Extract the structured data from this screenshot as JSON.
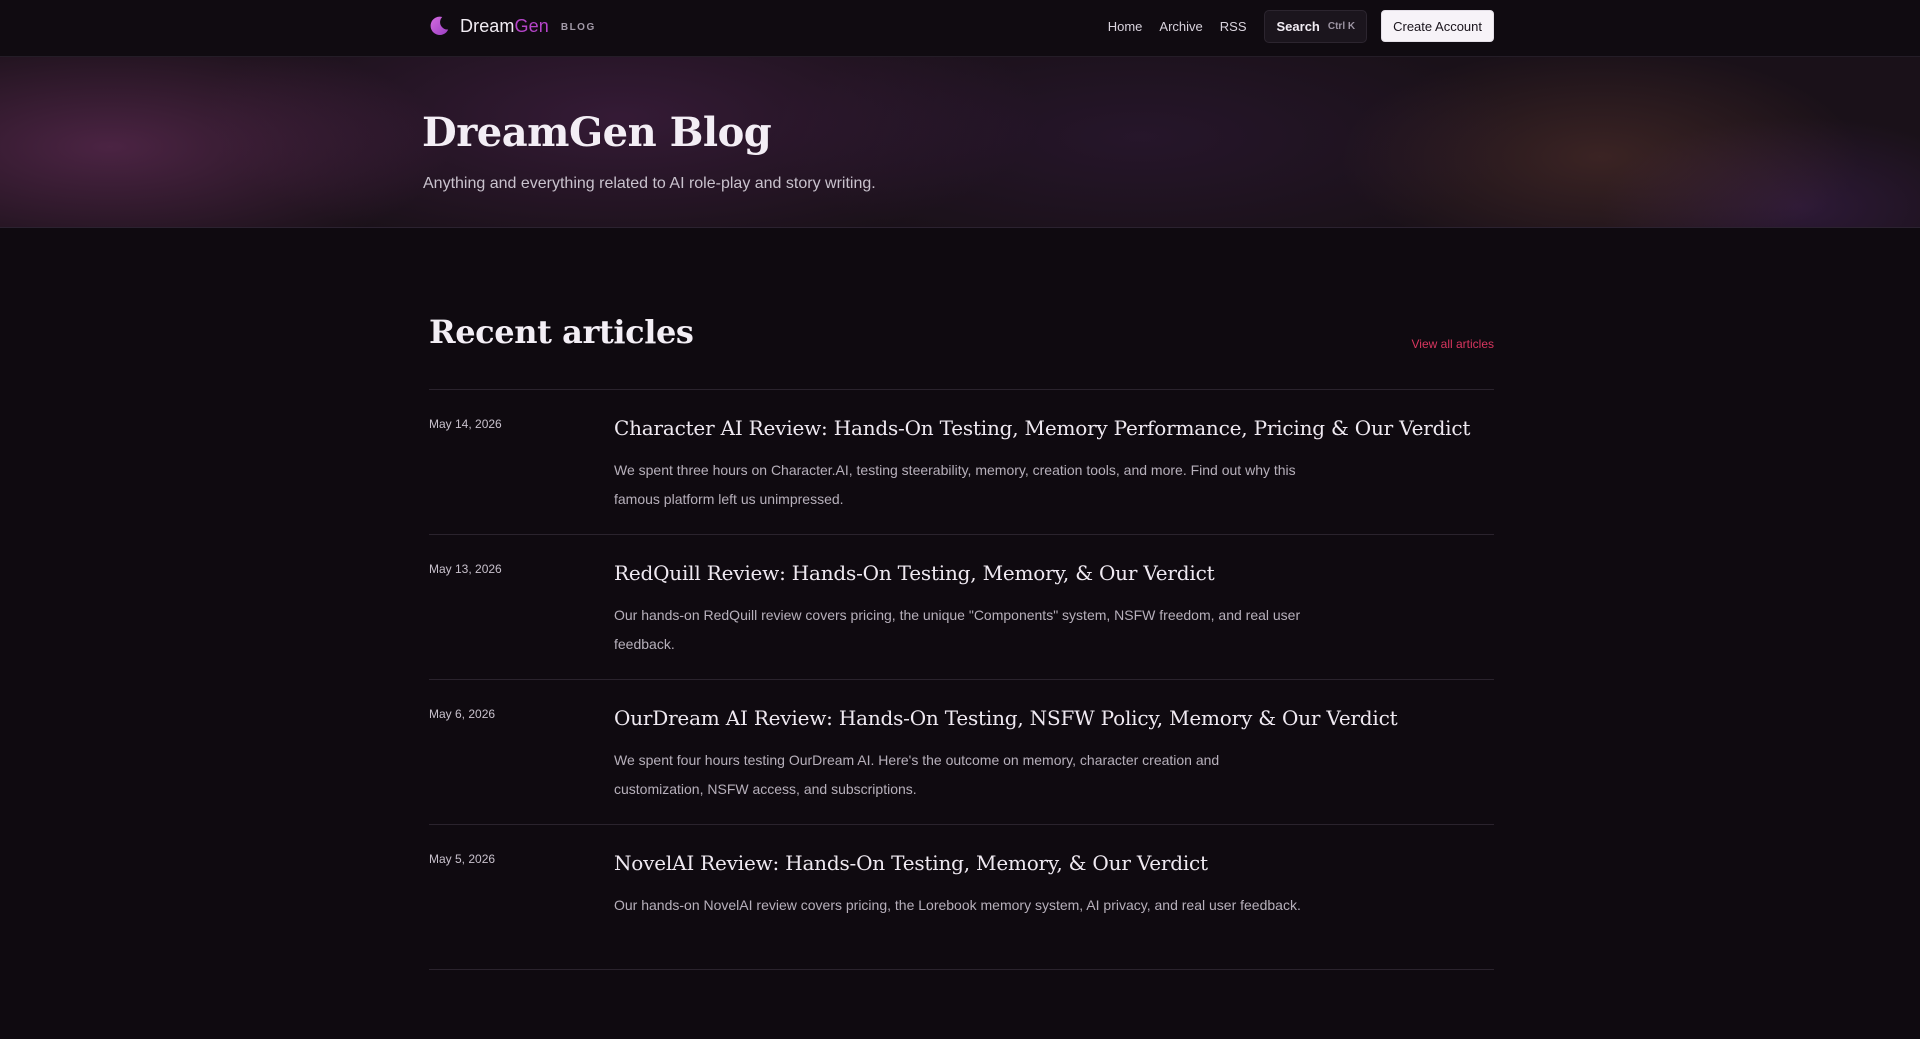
{
  "header": {
    "brand_dream": "Dream",
    "brand_gen": "Gen",
    "brand_tag": "BLOG",
    "nav": [
      {
        "label": "Home"
      },
      {
        "label": "Archive"
      },
      {
        "label": "RSS"
      }
    ],
    "search_label": "Search",
    "search_shortcut": "Ctrl K",
    "create_account_label": "Create Account"
  },
  "hero": {
    "title": "DreamGen Blog",
    "subtitle": "Anything and everything related to AI role-play and story writing."
  },
  "recent": {
    "title": "Recent articles",
    "view_all_label": "View all articles",
    "articles": [
      {
        "date": "May 14, 2026",
        "title": "Character AI Review: Hands-On Testing, Memory Performance, Pricing & Our Verdict",
        "description": "We spent three hours on Character.AI, testing steerability, memory, creation tools, and more. Find out why this famous platform left us unimpressed."
      },
      {
        "date": "May 13, 2026",
        "title": "RedQuill Review: Hands-On Testing, Memory, & Our Verdict",
        "description": "Our hands-on RedQuill review covers pricing, the unique \"Components\" system, NSFW freedom, and real user feedback."
      },
      {
        "date": "May 6, 2026",
        "title": "OurDream AI Review: Hands-On Testing, NSFW Policy, Memory & Our Verdict",
        "description": "We spent four hours testing OurDream AI. Here's the outcome on memory, character creation and customization, NSFW access, and subscriptions."
      },
      {
        "date": "May 5, 2026",
        "title": "NovelAI Review: Hands-On Testing, Memory, & Our Verdict",
        "description": "Our hands-on NovelAI review covers pricing, the Lorebook memory system, AI privacy, and real user feedback."
      }
    ]
  },
  "colors": {
    "background": "#0f0a10",
    "accent": "#b544c9",
    "link": "#d8365f"
  },
  "icons": {
    "logo": "crescent-moon-icon"
  }
}
